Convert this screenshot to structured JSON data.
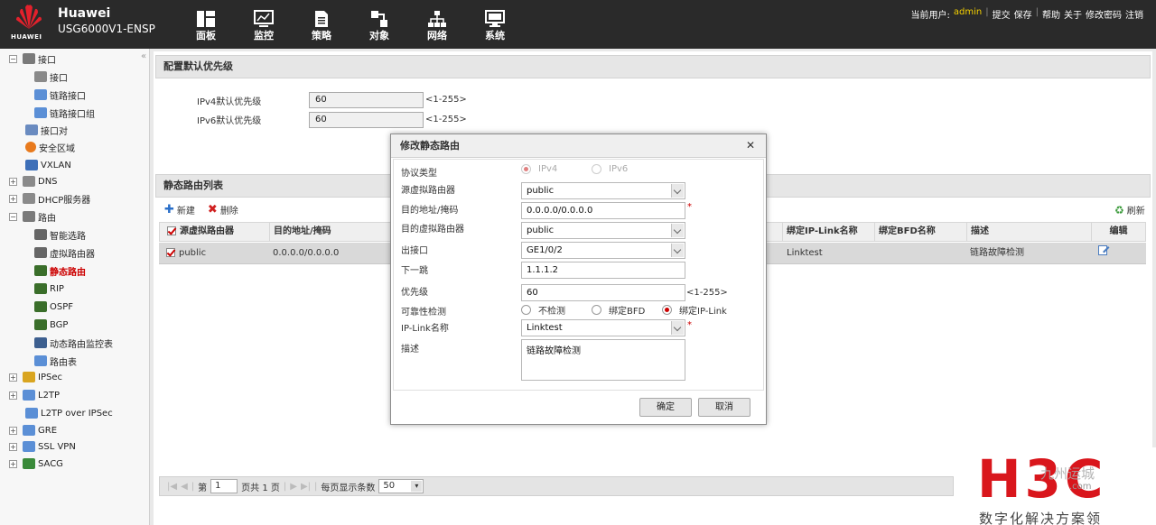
{
  "header": {
    "brand": "Huawei",
    "brand_small": "HUAWEI",
    "model": "USG6000V1-ENSP",
    "nav": [
      {
        "label": "面板",
        "icon": "dashboard-icon"
      },
      {
        "label": "监控",
        "icon": "monitor-icon"
      },
      {
        "label": "策略",
        "icon": "policy-icon"
      },
      {
        "label": "对象",
        "icon": "object-icon"
      },
      {
        "label": "网络",
        "icon": "network-icon"
      },
      {
        "label": "系统",
        "icon": "system-icon"
      }
    ],
    "user_prefix": "当前用户:",
    "user": "admin",
    "links": [
      "提交",
      "保存",
      "帮助",
      "关于",
      "修改密码",
      "注销"
    ]
  },
  "sidebar": {
    "items": [
      {
        "label": "接口",
        "expander": "−"
      },
      {
        "label": "接口"
      },
      {
        "label": "链路接口"
      },
      {
        "label": "链路接口组"
      },
      {
        "label": "接口对"
      },
      {
        "label": "安全区域"
      },
      {
        "label": "VXLAN"
      },
      {
        "label": "DNS",
        "expander": "+"
      },
      {
        "label": "DHCP服务器",
        "expander": "+"
      },
      {
        "label": "路由",
        "expander": "−"
      },
      {
        "label": "智能选路"
      },
      {
        "label": "虚拟路由器"
      },
      {
        "label": "静态路由"
      },
      {
        "label": "RIP"
      },
      {
        "label": "OSPF"
      },
      {
        "label": "BGP"
      },
      {
        "label": "动态路由监控表"
      },
      {
        "label": "路由表"
      },
      {
        "label": "IPSec",
        "expander": "+"
      },
      {
        "label": "L2TP",
        "expander": "+"
      },
      {
        "label": "L2TP over IPSec"
      },
      {
        "label": "GRE",
        "expander": "+"
      },
      {
        "label": "SSL VPN",
        "expander": "+"
      },
      {
        "label": "SACG",
        "expander": "+"
      }
    ]
  },
  "default_priority": {
    "title": "配置默认优先级",
    "ipv4_label": "IPv4默认优先级",
    "ipv4_value": "60",
    "ipv4_range": "<1-255>",
    "ipv6_label": "IPv6默认优先级",
    "ipv6_value": "60",
    "ipv6_range": "<1-255>"
  },
  "static_routes": {
    "title": "静态路由列表",
    "new_label": "新建",
    "delete_label": "删除",
    "refresh_label": "刷新",
    "columns": [
      "源虚拟路由器",
      "目的地址/掩码",
      "绑定IP-Link名称",
      "绑定BFD名称",
      "描述",
      "编辑"
    ],
    "rows": [
      {
        "vrouter": "public",
        "dest": "0.0.0.0/0.0.0.0",
        "iplink": "Linktest",
        "bfd": "",
        "desc": "链路故障检测"
      }
    ]
  },
  "pager": {
    "page_prefix": "第",
    "page": "1",
    "page_total": "页共 1 页",
    "per_page_label": "每页显示条数",
    "per_page": "50"
  },
  "dialog": {
    "title": "修改静态路由",
    "protocol_label": "协议类型",
    "ipv4": "IPv4",
    "ipv6": "IPv6",
    "src_vr_label": "源虚拟路由器",
    "src_vr_value": "public",
    "dest_label": "目的地址/掩码",
    "dest_value": "0.0.0.0/0.0.0.0",
    "dst_vr_label": "目的虚拟路由器",
    "dst_vr_value": "public",
    "out_if_label": "出接口",
    "out_if_value": "GE1/0/2",
    "next_hop_label": "下一跳",
    "next_hop_value": "1.1.1.2",
    "priority_label": "优先级",
    "priority_value": "60",
    "priority_range": "<1-255>",
    "reliability_label": "可靠性检测",
    "no_check": "不检测",
    "bind_bfd": "绑定BFD",
    "bind_iplink": "绑定IP-Link",
    "iplink_label": "IP-Link名称",
    "iplink_value": "Linktest",
    "desc_label": "描述",
    "desc_value": "链路故障检测",
    "required_mark": "*",
    "ok": "确定",
    "cancel": "取消"
  },
  "watermark": {
    "logo": "H3C",
    "slogan": "数字化解决方案领",
    "mark": "九州运城",
    "mark2": ".com"
  },
  "colors": {
    "topbar": "#2a2a2a",
    "accent_red": "#c00000",
    "user_yellow": "#f5d000",
    "h3c_red": "#d9161c"
  }
}
